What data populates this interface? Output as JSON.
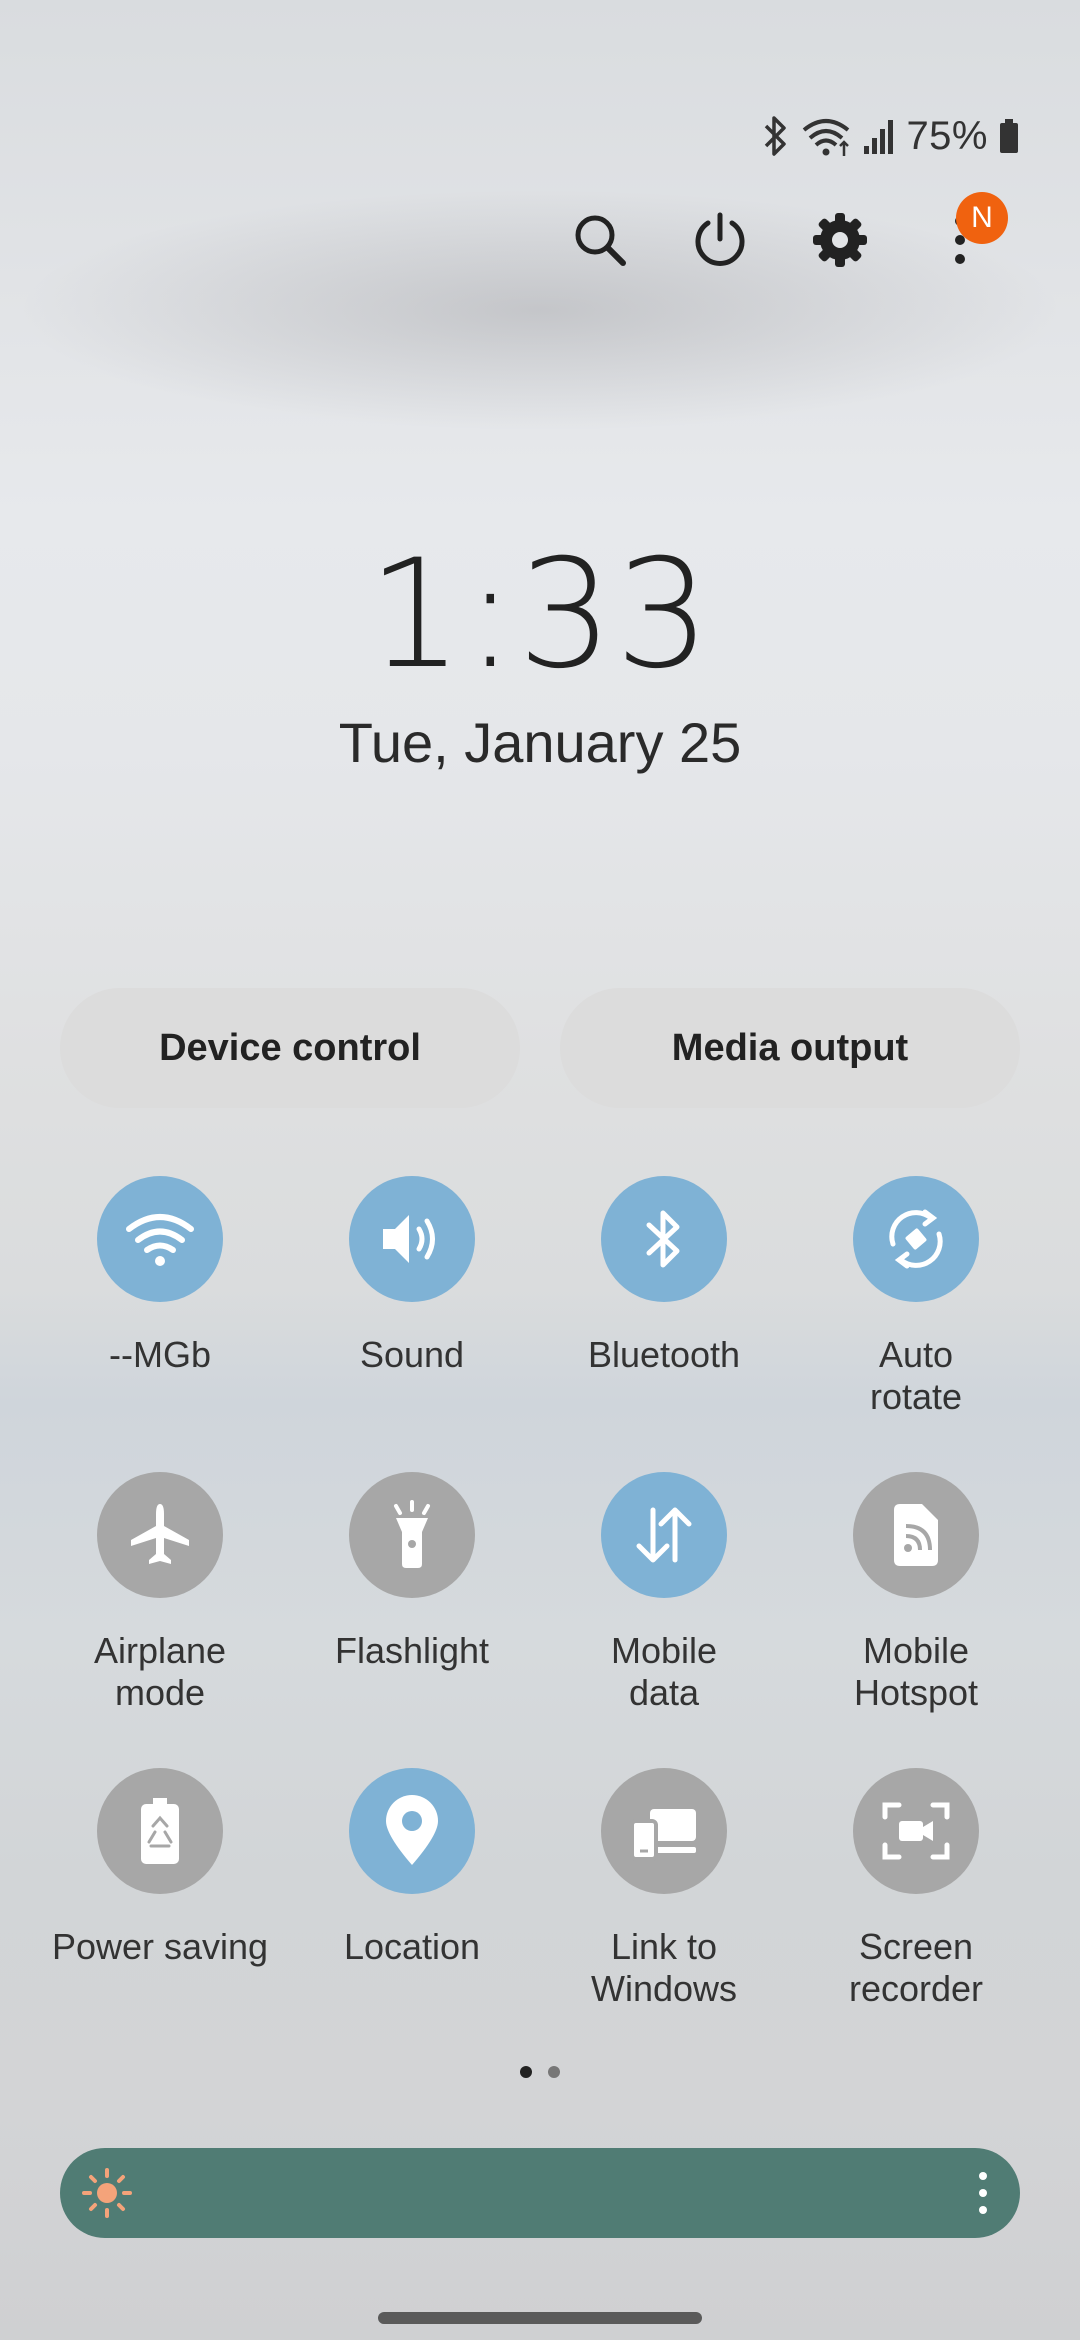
{
  "status_bar": {
    "battery_text": "75%",
    "icons": [
      "bluetooth-icon",
      "wifi-icon",
      "signal-icon",
      "battery-icon"
    ]
  },
  "top_actions": {
    "icons": [
      "search-icon",
      "power-icon",
      "settings-icon",
      "more-options-icon"
    ],
    "notification_badge": "N",
    "badge_color": "#f0620f"
  },
  "clock": {
    "time": "1:33",
    "date": "Tue, January 25"
  },
  "quick_buttons": {
    "device_control": "Device control",
    "media_output": "Media output"
  },
  "tiles": [
    {
      "label": "--MGb",
      "icon": "wifi-icon",
      "active": true
    },
    {
      "label": "Sound",
      "icon": "sound-icon",
      "active": true
    },
    {
      "label": "Bluetooth",
      "icon": "bluetooth-icon",
      "active": true
    },
    {
      "label": "Auto\nrotate",
      "icon": "auto-rotate-icon",
      "active": true
    },
    {
      "label": "Airplane\nmode",
      "icon": "airplane-icon",
      "active": false
    },
    {
      "label": "Flashlight",
      "icon": "flashlight-icon",
      "active": false
    },
    {
      "label": "Mobile\ndata",
      "icon": "mobile-data-icon",
      "active": true
    },
    {
      "label": "Mobile\nHotspot",
      "icon": "hotspot-icon",
      "active": false
    },
    {
      "label": "Power saving",
      "icon": "power-saving-icon",
      "active": false
    },
    {
      "label": "Location",
      "icon": "location-icon",
      "active": true
    },
    {
      "label": "Link to\nWindows",
      "icon": "link-to-windows-icon",
      "active": false
    },
    {
      "label": "Screen\nrecorder",
      "icon": "screen-recorder-icon",
      "active": false
    }
  ],
  "pager": {
    "current_page": 1,
    "total_pages": 2
  },
  "brightness": {
    "icons": [
      "brightness-sun-icon",
      "more-options-icon"
    ],
    "bar_color": "#507c74"
  },
  "colors": {
    "tile_on": "#7fb2d5",
    "tile_off": "#a7a7a7"
  }
}
